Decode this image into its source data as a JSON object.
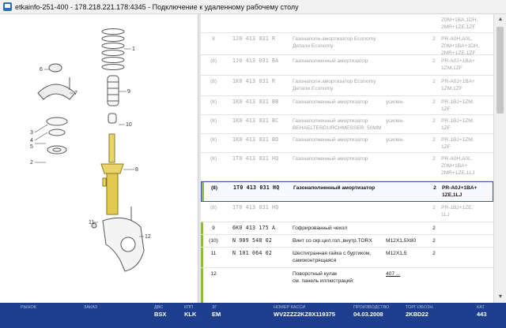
{
  "window": {
    "title": "etkainfo-251-400 - 178.218.221.178:4345 - Подключение к удаленному рабочему столу"
  },
  "diagram": {
    "callouts": [
      "1",
      "2",
      "3",
      "4",
      "5",
      "6",
      "7",
      "8",
      "9",
      "10",
      "11",
      "12"
    ]
  },
  "parts": [
    {
      "pos": "",
      "num": "",
      "name": "",
      "remark": "",
      "qty": "",
      "model": "Z0M+1BA,1DH,\n2MR+1ZE,1ZF",
      "state": "dim",
      "mark": false
    },
    {
      "pos": "8",
      "num": "1J0  413  031  R",
      "name": "Газонаполн.амортизатор Economy\nДетали Economy",
      "remark": "",
      "qty": "2",
      "model": "PR-A0H,A0L,\nZ0M+1BA+1DH,\n2MR+1ZE,1ZF",
      "state": "dim",
      "mark": false
    },
    {
      "pos": "(8)",
      "num": "1J0  413  031  BA",
      "name": "Газонаполненный амортизатор",
      "remark": "",
      "qty": "2",
      "model": "PR-A0J+1BA+\n1ZM,1ZF",
      "state": "dim",
      "mark": false
    },
    {
      "pos": "(8)",
      "num": "1K0  413  031  R",
      "name": "Газонаполн.амортизатор Economy\nДетали Economy",
      "remark": "",
      "qty": "2",
      "model": "PR-A0J+1BA+\n1ZM,1ZF",
      "state": "dim",
      "mark": false
    },
    {
      "pos": "(8)",
      "num": "1K0  413  031  BB",
      "name": "Газонаполненный амортизатор",
      "remark": "усилен.",
      "qty": "2",
      "model": "PR-1BJ+1ZM,\n1ZF",
      "state": "dim",
      "mark": false
    },
    {
      "pos": "(8)",
      "num": "1K0  413  031  BC",
      "name": "Газонаполненный амортизатор\nBEHAELTERDURCHMESSER: 50MM",
      "remark": "усилен.",
      "qty": "2",
      "model": "PR-1BJ+1ZM,\n1ZF",
      "state": "dim",
      "mark": false
    },
    {
      "pos": "(8)",
      "num": "1K0  413  031  BD",
      "name": "Газонаполненный амортизатор",
      "remark": "усилен.",
      "qty": "2",
      "model": "PR-1BJ+1ZM,\n1ZF",
      "state": "dim",
      "mark": false
    },
    {
      "pos": "(8)",
      "num": "1T0  413  031  HQ",
      "name": "Газонаполненный амортизатор",
      "remark": "",
      "qty": "2",
      "model": "PR-A0H,A0L,\nZ0M+1BA+\n2MR+1ZE,1LJ",
      "state": "dim",
      "mark": false
    },
    {
      "pos": "(8)",
      "num": "1T0  413  031  HQ",
      "name": "Газонаполненный амортизатор",
      "remark": "",
      "qty": "2",
      "model": "PR-A0J+1BA+\n1ZE,1LJ",
      "state": "active",
      "mark": true
    },
    {
      "pos": "(8)",
      "num": "1T0  413  031  HQ",
      "name": "",
      "remark": "",
      "qty": "2",
      "model": "PR-1BJ+1ZE,\n1LJ",
      "state": "dim",
      "mark": false
    },
    {
      "pos": "9",
      "num": "6K0  413  175  A",
      "name": "Гофрированный чехол",
      "remark": "",
      "qty": "2",
      "model": "",
      "state": "normal",
      "mark": true
    },
    {
      "pos": "(10)",
      "num": "N   909  548  02",
      "name": "Винт со скр.цил.гол.,внутр.TORX",
      "remark": "M12X1,5X80",
      "qty": "2",
      "model": "",
      "state": "normal",
      "mark": true
    },
    {
      "pos": "11",
      "num": "N   101  064  02",
      "name": "Шестигранная гайка с буртиком,\nсамоконтрящаяся",
      "remark": "M12X1,5",
      "qty": "2",
      "model": "",
      "state": "normal",
      "mark": true
    },
    {
      "pos": "12",
      "num": "",
      "name": "Поворотный кулак\n см. панель иллюстраций:",
      "remark": "407 ...",
      "qty": "",
      "model": "",
      "state": "normal",
      "mark": true
    }
  ],
  "status": {
    "market_label": "РЫНОК",
    "market_value": "",
    "order_label": "ЗАКАЗ",
    "order_value": "",
    "engine_label": "ДВС",
    "engine_value": "BSX",
    "gearbox_label": "КПП",
    "gearbox_value": "KLK",
    "axle_label": "ЗГ",
    "axle_value": "EM",
    "body_label": "НОМЕР КАССИ",
    "body_value": "WV2ZZZ2KZ8X119375",
    "proddate_label": "ПРОИЗВОДСТВО",
    "proddate_value": "04.03.2008",
    "color_label": "ТОРГ.ОБОЗН.",
    "color_value": "2KBD22",
    "cat_label": "КАТ",
    "cat_value": "443"
  }
}
